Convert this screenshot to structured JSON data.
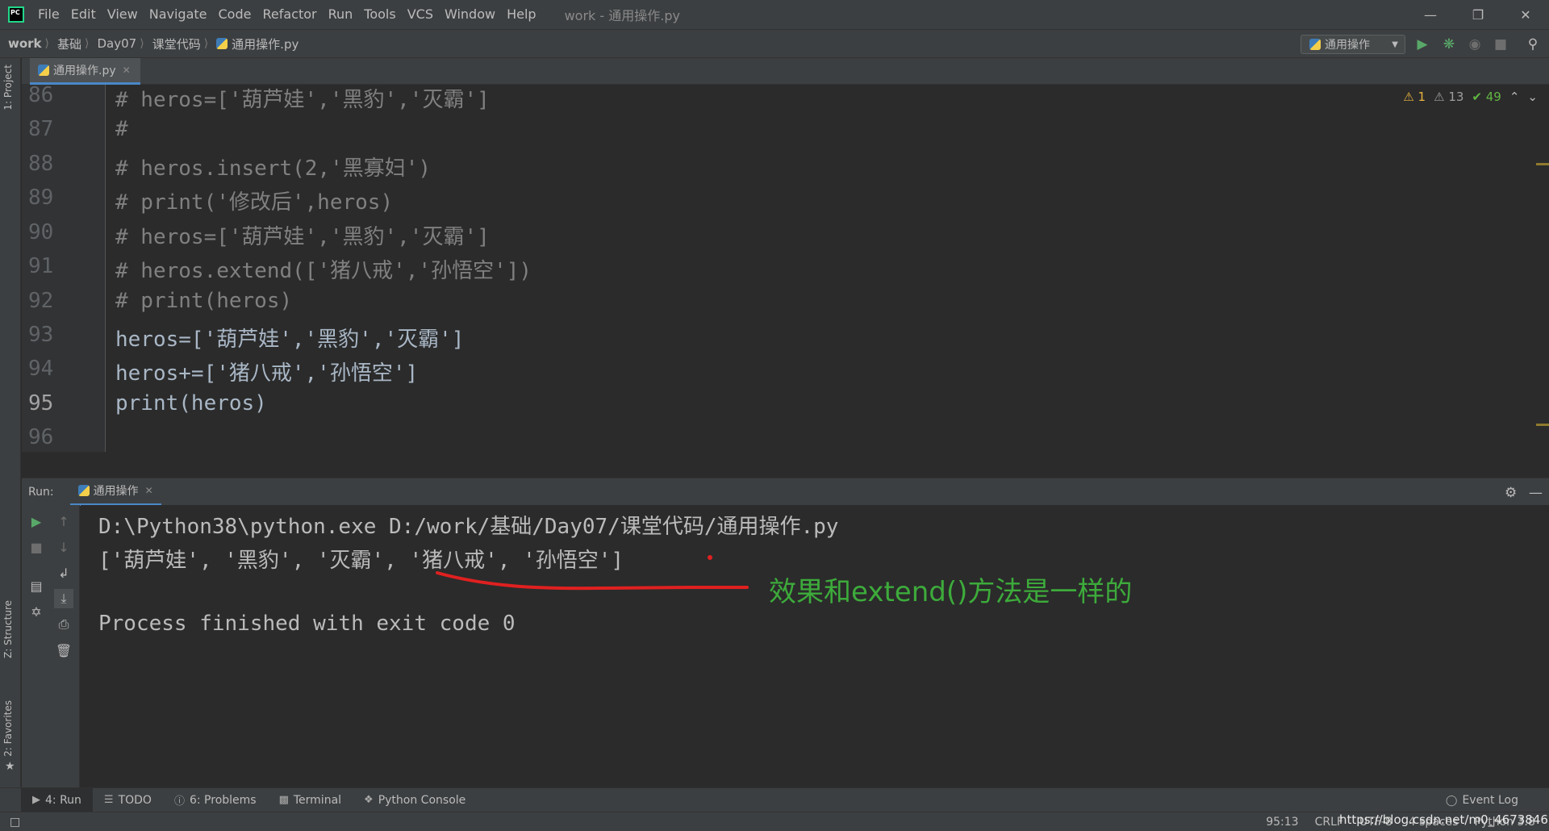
{
  "menubar": {
    "items": [
      "File",
      "Edit",
      "View",
      "Navigate",
      "Code",
      "Refactor",
      "Run",
      "Tools",
      "VCS",
      "Window",
      "Help"
    ],
    "window_title": "work - 通用操作.py"
  },
  "navbar": {
    "breadcrumbs": [
      "work",
      "基础",
      "Day07",
      "课堂代码",
      "通用操作.py"
    ],
    "run_config": "通用操作"
  },
  "left_strip": {
    "project": "1: Project",
    "structure": "Z: Structure",
    "favorites": "2: Favorites"
  },
  "editor": {
    "tab_label": "通用操作.py",
    "inspections": {
      "errors": "1",
      "warnings": "13",
      "weak_warnings": "49"
    },
    "current_line": 95,
    "lines": [
      {
        "num": "86",
        "text": "# heros=['葫芦娃','黑豹','灭霸']"
      },
      {
        "num": "87",
        "text": "#"
      },
      {
        "num": "88",
        "text": "# heros.insert(2,'黑寡妇')"
      },
      {
        "num": "89",
        "text": "# print('修改后',heros)"
      },
      {
        "num": "90",
        "text": "# heros=['葫芦娃','黑豹','灭霸']"
      },
      {
        "num": "91",
        "text": "# heros.extend(['猪八戒','孙悟空'])"
      },
      {
        "num": "92",
        "text": "# print(heros)"
      },
      {
        "num": "93",
        "text": "heros=['葫芦娃','黑豹','灭霸']"
      },
      {
        "num": "94",
        "text": "heros+=['猪八戒','孙悟空']"
      },
      {
        "num": "95",
        "text": "print(heros)"
      },
      {
        "num": "96",
        "text": ""
      }
    ]
  },
  "run_panel": {
    "label": "Run:",
    "tab_label": "通用操作",
    "output": [
      "D:\\Python38\\python.exe D:/work/基础/Day07/课堂代码/通用操作.py",
      "['葫芦娃', '黑豹', '灭霸', '猪八戒', '孙悟空']",
      "",
      "Process finished with exit code 0"
    ],
    "annotation": "效果和extend()方法是一样的",
    "annotation_color": "#3dab3b"
  },
  "bottom_tools": {
    "items": [
      "4: Run",
      "TODO",
      "6: Problems",
      "Terminal",
      "Python Console"
    ],
    "event_log": "Event Log"
  },
  "statusbar": {
    "position": "95:13",
    "line_sep": "CRLF",
    "encoding": "UTF-8",
    "indent": "4 spaces",
    "interpreter": "Python 3.8",
    "watermark": "https://blog.csdn.net/m0_46738467"
  }
}
